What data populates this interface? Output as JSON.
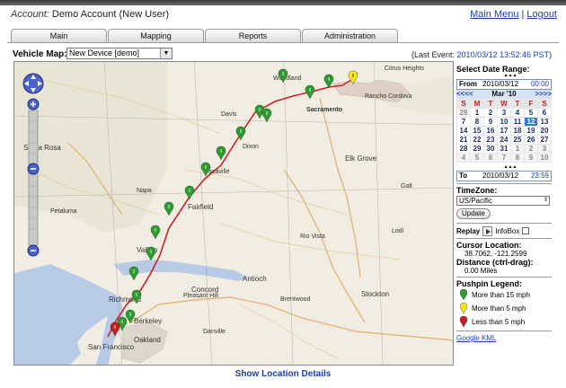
{
  "account": {
    "label": "Account:",
    "name": "Demo Account (New User)"
  },
  "top_links": {
    "main_menu": "Main Menu",
    "separator": "|",
    "logout": "Logout"
  },
  "tabs": [
    "Main",
    "Mapping",
    "Reports",
    "Administration"
  ],
  "vehicle_map": {
    "label": "Vehicle Map:",
    "selected": "New Device [demo]"
  },
  "last_event": {
    "label": "(Last Event:",
    "value": "2010/03/12 13:52:46 PST",
    "close": ")"
  },
  "map": {
    "places": [
      "Woodland",
      "Sacramento",
      "Citrus Heights",
      "Rancho Cordova",
      "Davis",
      "Dixon",
      "Elk Grove",
      "Santa Rosa",
      "Napa",
      "Fairfield",
      "Vacaville",
      "Petaluma",
      "Vallejo",
      "Concord",
      "Antioch",
      "Stockton",
      "Richmond",
      "Berkeley",
      "Oakland",
      "San Francisco",
      "Pleasant Hill",
      "Danville",
      "Brentwood",
      "Rio Vista",
      "Lodi",
      "Galt"
    ],
    "pushpin_colors": {
      "fast": "#2f9a2f",
      "medium": "#f2e51a",
      "slow": "#c32020"
    },
    "route_color": "#cc2222"
  },
  "show_details": "Show Location Details",
  "sidebar": {
    "select_date_range": "Select Date Range:",
    "from": {
      "label": "From",
      "date": "2010/03/12",
      "time": "00:00"
    },
    "calendar": {
      "prev": "<<<<",
      "month": "Mar '10",
      "next": ">>>>",
      "dow": [
        "S",
        "M",
        "T",
        "W",
        "T",
        "F",
        "S"
      ],
      "weeks": [
        [
          "28",
          "1",
          "2",
          "3",
          "4",
          "5",
          "6"
        ],
        [
          "7",
          "8",
          "9",
          "10",
          "11",
          "12",
          "13"
        ],
        [
          "14",
          "15",
          "16",
          "17",
          "18",
          "19",
          "20"
        ],
        [
          "21",
          "22",
          "23",
          "24",
          "25",
          "26",
          "27"
        ],
        [
          "28",
          "29",
          "30",
          "31",
          "1",
          "2",
          "3"
        ],
        [
          "4",
          "5",
          "6",
          "7",
          "8",
          "9",
          "10"
        ]
      ]
    },
    "to": {
      "label": "To",
      "date": "2010/03/12",
      "time": "23:59"
    },
    "timezone": {
      "label": "TimeZone:",
      "selected": "US/Pacific"
    },
    "update_button": "Update",
    "replay": {
      "label": "Replay",
      "infobox": "InfoBox"
    },
    "cursor_location": {
      "label": "Cursor Location:",
      "value": "38.7062, -121.2599"
    },
    "distance": {
      "label": "Distance (ctrl-drag):",
      "value": "0.00 Miles"
    },
    "legend": {
      "title": "Pushpin Legend:",
      "items": [
        {
          "label": "More than 15 mph",
          "color": "#2f9a2f"
        },
        {
          "label": "More than 5 mph",
          "color": "#f2e51a"
        },
        {
          "label": "Less than 5 mph",
          "color": "#c32020"
        }
      ]
    },
    "google_kml": "Google KML"
  }
}
